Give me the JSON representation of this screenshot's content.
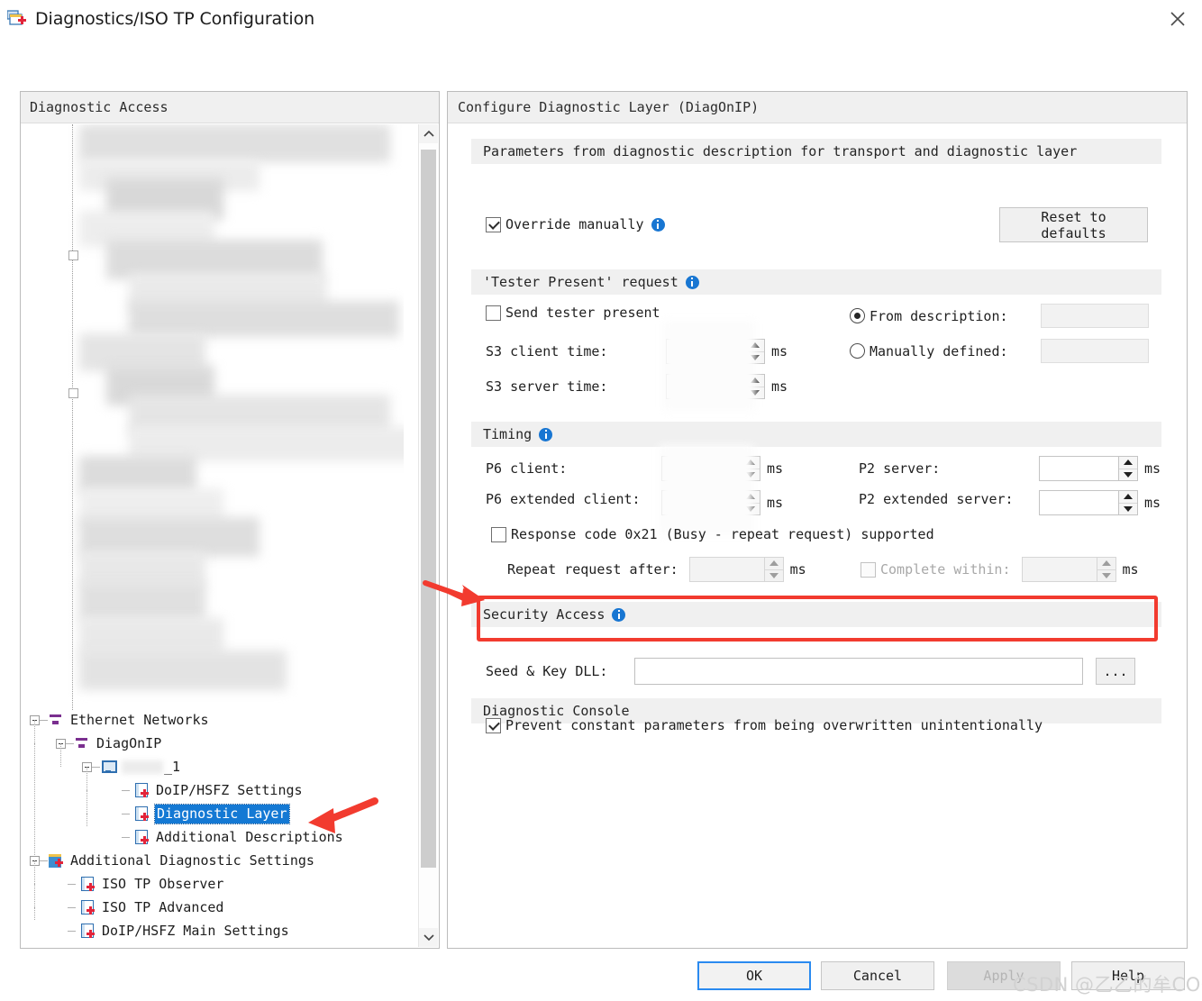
{
  "window": {
    "title": "Diagnostics/ISO TP Configuration",
    "icon": "diagnostics-config-icon",
    "close_label": "✕"
  },
  "left_panel": {
    "header": "Diagnostic Access",
    "tree": [
      {
        "label": "Ethernet Networks",
        "icon": "network-icon",
        "depth": 0,
        "expander": "minus",
        "selected": false
      },
      {
        "label": "DiagOnIP",
        "icon": "network-icon",
        "depth": 1,
        "expander": "minus",
        "selected": false
      },
      {
        "label": "_1",
        "icon": "computer-icon",
        "depth": 2,
        "expander": "minus",
        "selected": false,
        "redacted_prefix": true
      },
      {
        "label": "DoIP/HSFZ Settings",
        "icon": "document-add-icon",
        "depth": 3,
        "expander": "none",
        "selected": false
      },
      {
        "label": "Diagnostic Layer",
        "icon": "document-add-icon",
        "depth": 3,
        "expander": "none",
        "selected": true
      },
      {
        "label": "Additional Descriptions",
        "icon": "document-add-icon",
        "depth": 3,
        "expander": "none",
        "selected": false
      },
      {
        "label": "Additional Diagnostic Settings",
        "icon": "folder-add-icon",
        "depth": 0,
        "expander": "minus",
        "selected": false
      },
      {
        "label": "ISO TP Observer",
        "icon": "document-add-icon",
        "depth": 1,
        "expander": "none",
        "selected": false
      },
      {
        "label": "ISO TP Advanced",
        "icon": "document-add-icon",
        "depth": 1,
        "expander": "none",
        "selected": false
      },
      {
        "label": "DoIP/HSFZ Main Settings",
        "icon": "document-add-icon",
        "depth": 1,
        "expander": "none",
        "selected": false
      }
    ]
  },
  "right_panel": {
    "header": "Configure Diagnostic Layer (DiagOnIP)",
    "params_section": {
      "title": "Parameters from diagnostic description for transport and diagnostic layer",
      "override_label": "Override manually",
      "override_checked": true,
      "reset_button_line1": "Reset to",
      "reset_button_line2": "defaults"
    },
    "tester_present": {
      "title": "'Tester Present' request",
      "send_label": "Send tester present",
      "send_checked": false,
      "s3_client_label": "S3 client time:",
      "s3_client_value": "",
      "s3_client_unit": "ms",
      "s3_server_label": "S3 server time:",
      "s3_server_value": "----",
      "s3_server_unit": "ms",
      "from_description_label": "From description:",
      "from_description_selected": true,
      "from_description_value": "",
      "manually_defined_label": "Manually defined:",
      "manually_defined_selected": false,
      "manually_defined_value": ""
    },
    "timing": {
      "title": "Timing",
      "p6_client_label": "P6 client:",
      "p6_client_value": "",
      "p6_extended_client_label": "P6 extended client:",
      "p6_extended_client_value": "",
      "p2_server_label": "P2 server:",
      "p2_server_value": "",
      "p2_extended_server_label": "P2 extended server:",
      "p2_extended_server_value": "",
      "unit": "ms",
      "response_code_label": "Response code 0x21 (Busy - repeat request) supported",
      "response_code_checked": false,
      "repeat_request_label": "Repeat request after:",
      "repeat_request_value": "",
      "complete_within_label": "Complete within:",
      "complete_within_checked": false,
      "complete_within_value": ""
    },
    "security_access": {
      "title": "Security Access",
      "seed_key_label": "Seed & Key DLL:",
      "seed_key_value": "",
      "browse_button": "...",
      "highlight_color": "#f23b2f"
    },
    "diagnostic_console": {
      "title": "Diagnostic Console",
      "prevent_label": "Prevent constant parameters from being overwritten unintentionally",
      "prevent_checked": true
    }
  },
  "footer": {
    "ok": "OK",
    "cancel": "Cancel",
    "apply": "Apply",
    "apply_disabled": true,
    "help": "Help"
  },
  "watermark": "CSDN @乙乙的牟COOL"
}
